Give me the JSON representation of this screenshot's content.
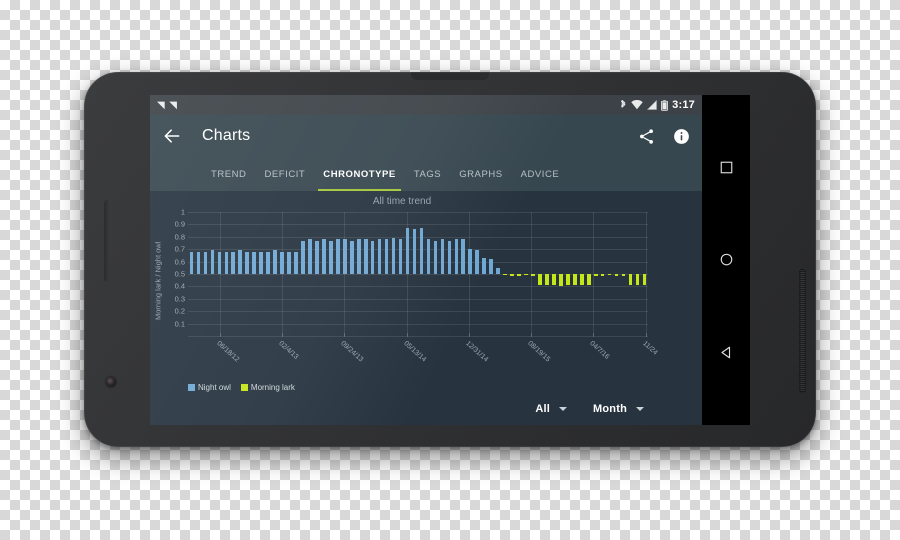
{
  "status_bar": {
    "notification_icons": [
      "notification-n-icon",
      "notification-n-icon"
    ],
    "bluetooth_icon": "bluetooth-icon",
    "wifi_icon": "wifi-icon",
    "signal_icon": "cellular-signal-icon",
    "battery_icon": "battery-icon",
    "clock": "3:17"
  },
  "app_bar": {
    "back_icon": "back-arrow-icon",
    "title": "Charts",
    "share_icon": "share-icon",
    "info_icon": "info-icon"
  },
  "tabs": [
    {
      "label": "TREND",
      "active": false
    },
    {
      "label": "DEFICIT",
      "active": false
    },
    {
      "label": "CHRONOTYPE",
      "active": true
    },
    {
      "label": "TAGS",
      "active": false
    },
    {
      "label": "GRAPHS",
      "active": false
    },
    {
      "label": "ADVICE",
      "active": false
    }
  ],
  "tab_indicator_color": "#a4c639",
  "legend": [
    {
      "label": "Night owl",
      "color": "#6fa8d4"
    },
    {
      "label": "Morning lark",
      "color": "#c5e717"
    }
  ],
  "selectors": [
    {
      "name": "range-selector",
      "value": "All"
    },
    {
      "name": "period-selector",
      "value": "Month"
    }
  ],
  "nav_bar": {
    "recents_icon": "square-recents-icon",
    "home_icon": "circle-home-icon",
    "back_icon": "triangle-back-icon"
  },
  "chart_data": {
    "type": "bar",
    "title": "All time trend",
    "xlabel": "",
    "ylabel": "Morning lark / Night owl",
    "ylim": [
      0,
      1
    ],
    "baseline": 0.5,
    "grid": true,
    "legend_position": "bottom-left",
    "ytick_labels": [
      "1",
      "0.9",
      "0.8",
      "0.7",
      "0.6",
      "0.5",
      "0.4",
      "0.3",
      "0.2",
      "0.1"
    ],
    "ytick_values": [
      1,
      0.9,
      0.8,
      0.7,
      0.6,
      0.5,
      0.4,
      0.3,
      0.2,
      0.1
    ],
    "xtick_labels": [
      "06/18/12",
      "02/4/13",
      "09/24/13",
      "05/13/14",
      "12/31/14",
      "08/19/15",
      "04/7/16",
      "11/24"
    ],
    "xtick_positions": [
      0.07,
      0.205,
      0.34,
      0.475,
      0.61,
      0.745,
      0.88,
      0.995
    ],
    "series": [
      {
        "name": "Night owl",
        "color": "#6fa8d4",
        "values": [
          0.68,
          0.68,
          0.68,
          0.69,
          0.68,
          0.68,
          0.68,
          0.69,
          0.68,
          0.68,
          0.68,
          0.68,
          0.69,
          0.68,
          0.68,
          0.68,
          0.77,
          0.78,
          0.77,
          0.78,
          0.77,
          0.78,
          0.78,
          0.77,
          0.78,
          0.78,
          0.77,
          0.78,
          0.78,
          0.79,
          0.78,
          0.87,
          0.86,
          0.87,
          0.78,
          0.77,
          0.78,
          0.77,
          0.78,
          0.78,
          0.7,
          0.69,
          0.63,
          0.62,
          0.55
        ]
      },
      {
        "name": "Morning lark",
        "color": "#c5e717",
        "values": [
          0.49,
          0.48,
          0.48,
          0.49,
          0.48,
          0.41,
          0.41,
          0.41,
          0.4,
          0.41,
          0.41,
          0.41,
          0.41,
          0.48,
          0.48,
          0.49,
          0.48,
          0.48,
          0.41,
          0.41,
          0.41
        ]
      }
    ]
  }
}
